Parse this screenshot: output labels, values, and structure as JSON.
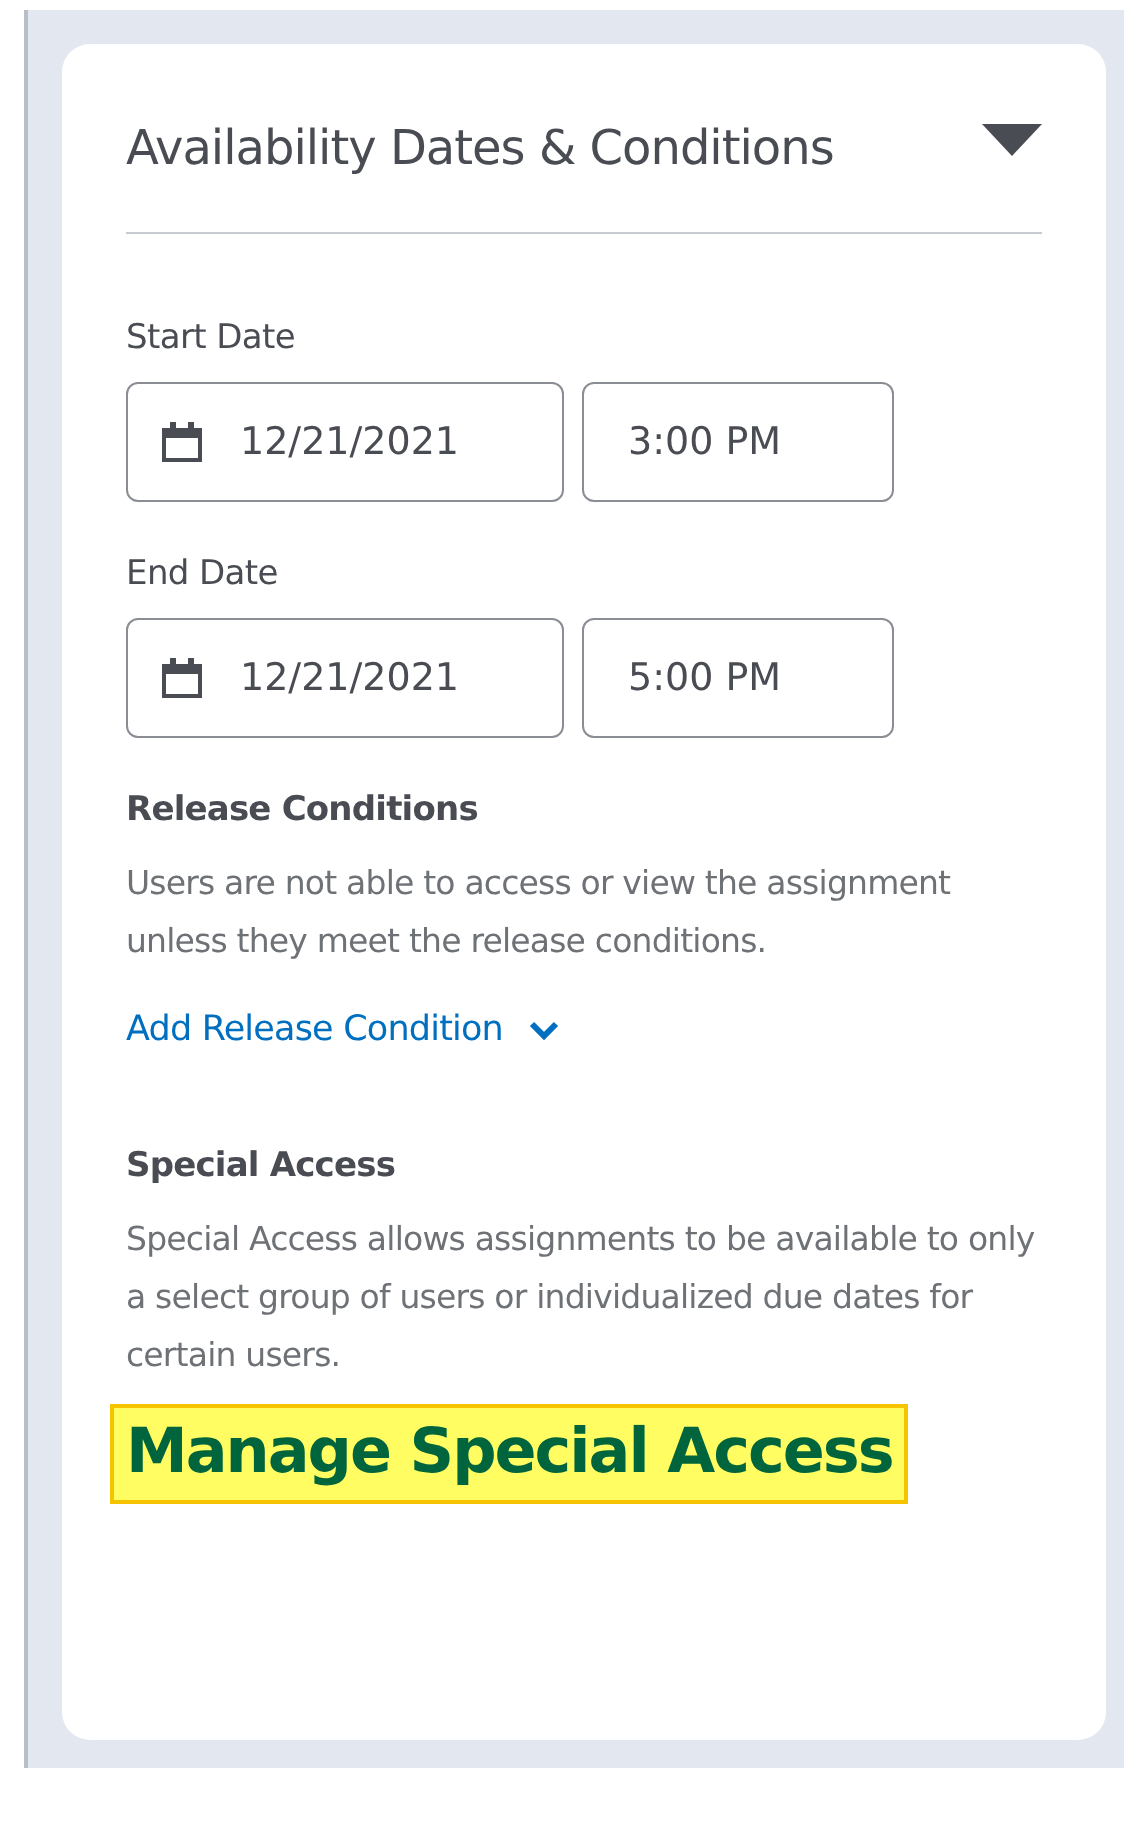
{
  "panel": {
    "title": "Availability Dates & Conditions",
    "expanded": true
  },
  "date_fields": [
    {
      "label": "Start Date",
      "date": "12/21/2021",
      "time": "3:00 PM"
    },
    {
      "label": "End Date",
      "date": "12/21/2021",
      "time": "5:00 PM"
    }
  ],
  "release_conditions": {
    "heading": "Release Conditions",
    "description": "Users are not able to access or view the assignment unless they meet the release conditions.",
    "link": "Add Release Condition"
  },
  "special_access": {
    "heading": "Special Access",
    "description": "Special Access allows assignments to be available to only a select group of users or individualized due dates for certain users.",
    "link": "Manage Special Access",
    "highlighted": true
  }
}
